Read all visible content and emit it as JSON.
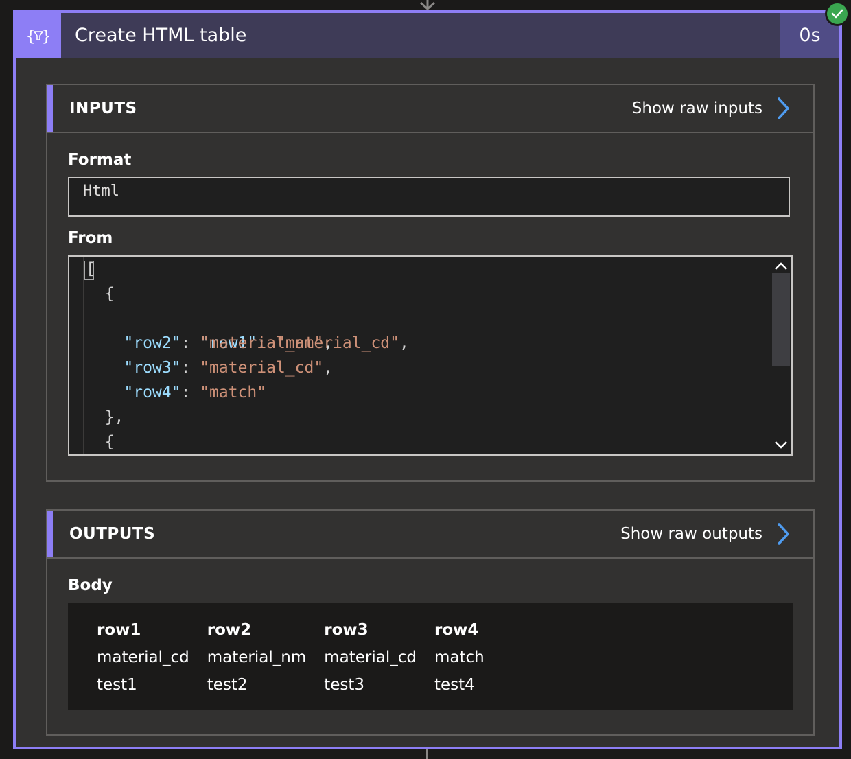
{
  "action": {
    "title": "Create HTML table",
    "duration": "0s",
    "icon": "curly-braces-filter-icon",
    "status_icon": "check-icon",
    "accent_color": "#8d7ef5",
    "status_color": "#3aa650"
  },
  "inputs": {
    "title": "INPUTS",
    "raw_link": "Show raw inputs",
    "format_label": "Format",
    "format_value": "Html",
    "from_label": "From",
    "code_lines": [
      "[",
      "  {",
      "    \"row1\": \"material_cd\",",
      "    \"row2\": \"material_nm\",",
      "    \"row3\": \"material_cd\",",
      "    \"row4\": \"match\"",
      "  },",
      "  {"
    ]
  },
  "outputs": {
    "title": "OUTPUTS",
    "raw_link": "Show raw outputs",
    "body_label": "Body",
    "table": {
      "headers": [
        "row1",
        "row2",
        "row3",
        "row4"
      ],
      "rows": [
        [
          "material_cd",
          "material_nm",
          "material_cd",
          "match"
        ],
        [
          "test1",
          "test2",
          "test3",
          "test4"
        ]
      ]
    }
  }
}
